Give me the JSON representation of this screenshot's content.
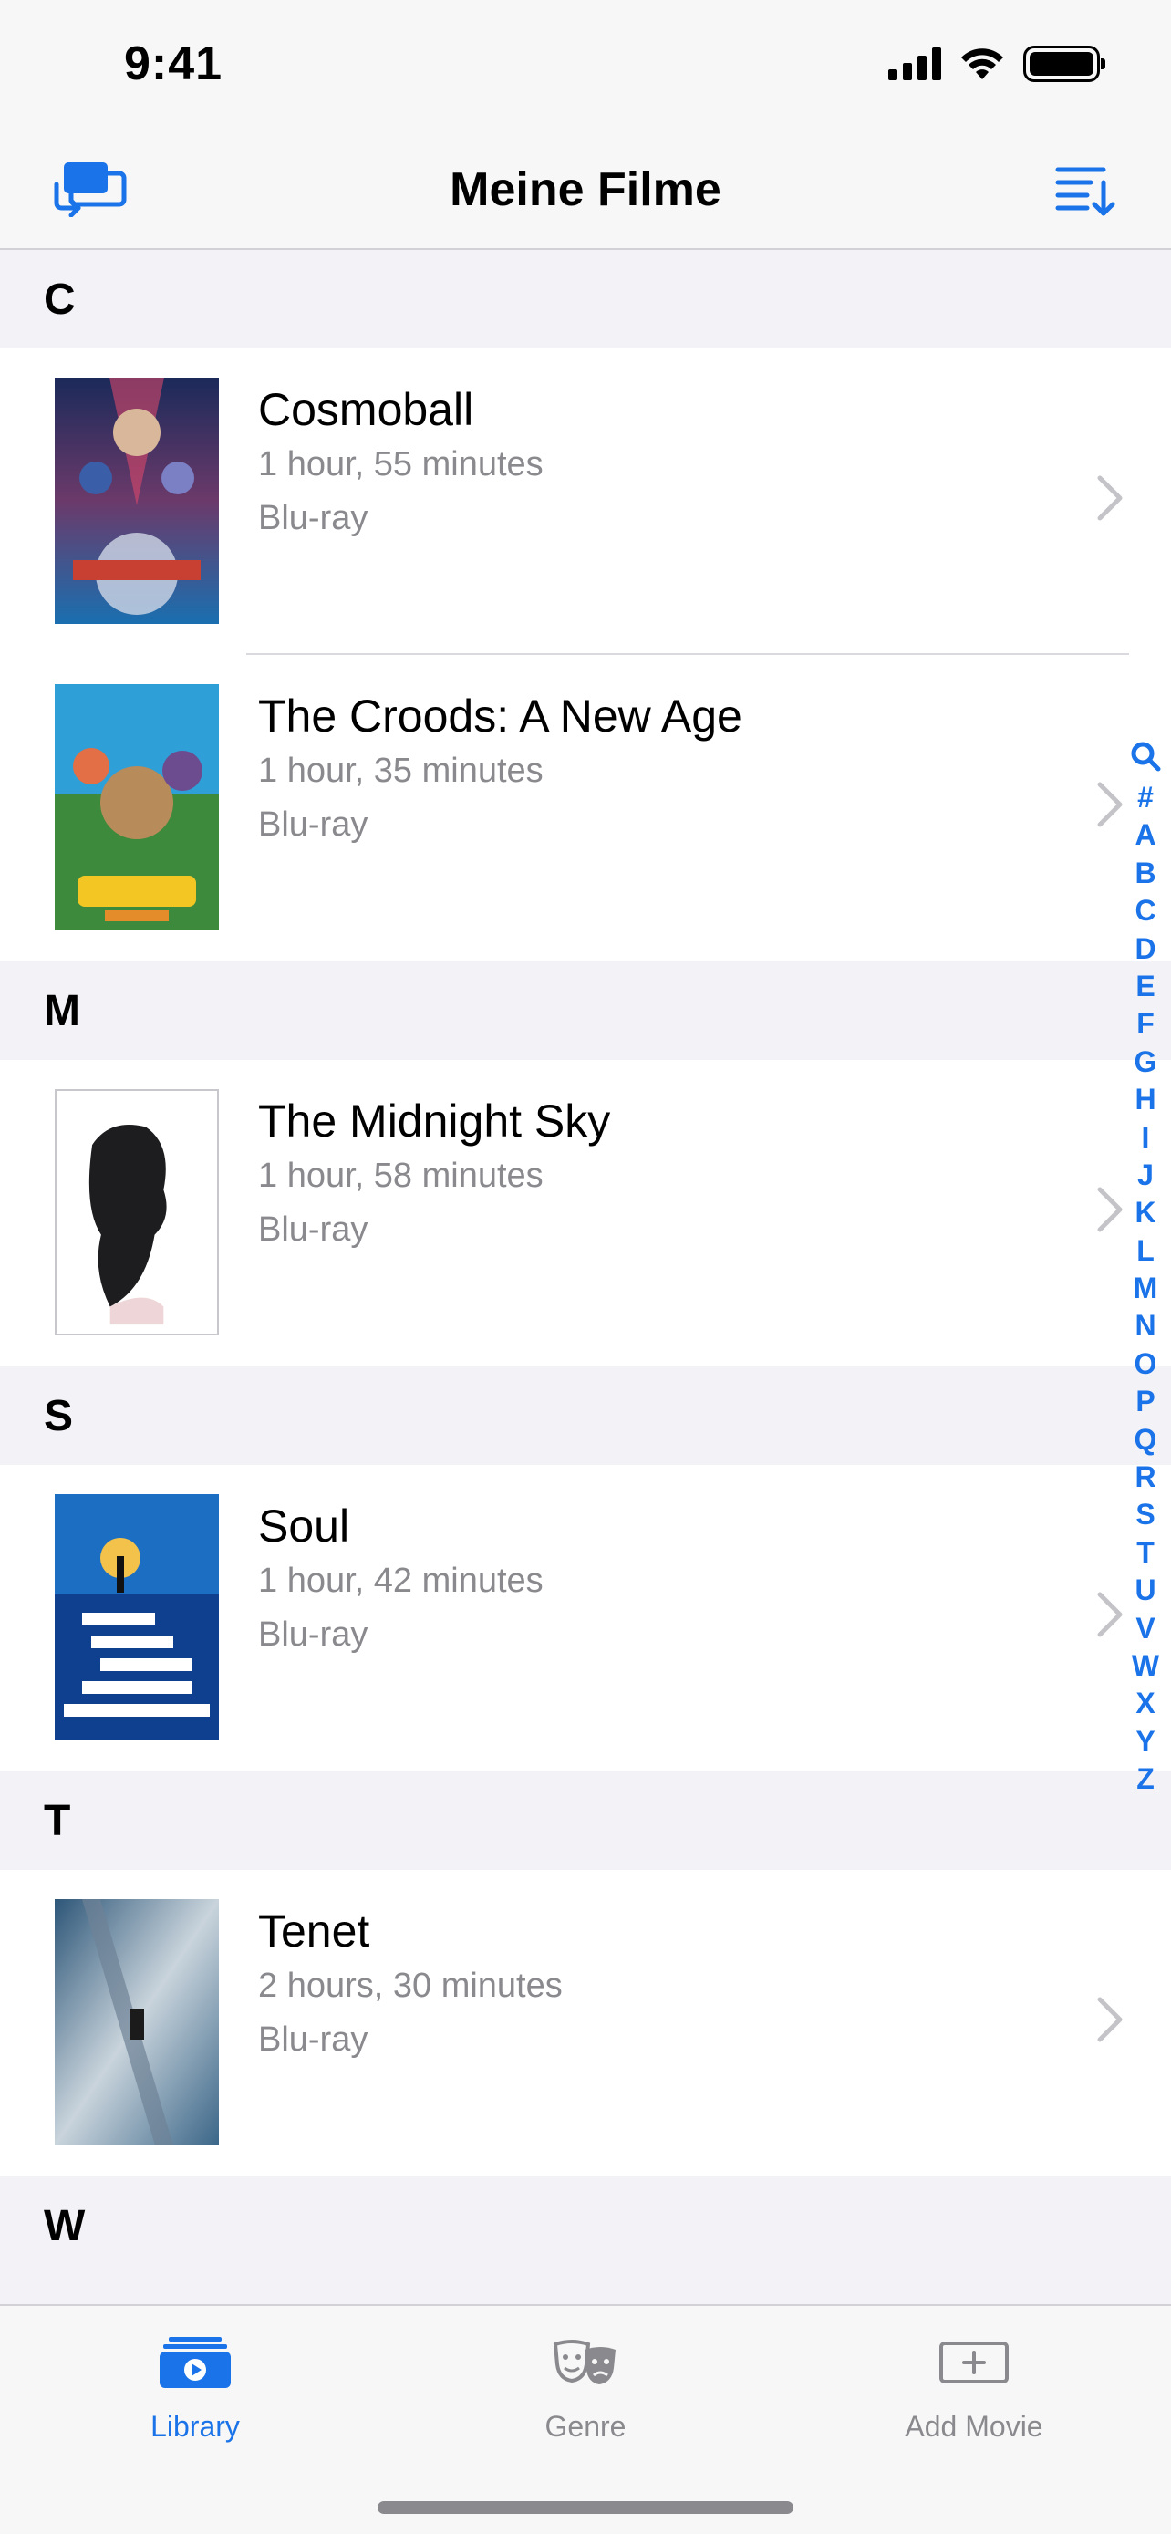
{
  "status": {
    "time": "9:41"
  },
  "nav": {
    "title": "Meine Filme",
    "left_icon": "cast-to-device-icon",
    "right_icon": "sort-icon"
  },
  "accent_color": "#1a73e8",
  "sections": [
    {
      "letter": "C",
      "movies": [
        {
          "title": "Cosmoball",
          "duration": "1 hour, 55 minutes",
          "format": "Blu-ray"
        },
        {
          "title": "The Croods: A New Age",
          "duration": "1 hour, 35 minutes",
          "format": "Blu-ray"
        }
      ]
    },
    {
      "letter": "M",
      "movies": [
        {
          "title": "The Midnight Sky",
          "duration": "1 hour, 58 minutes",
          "format": "Blu-ray"
        }
      ]
    },
    {
      "letter": "S",
      "movies": [
        {
          "title": "Soul",
          "duration": "1 hour, 42 minutes",
          "format": "Blu-ray"
        }
      ]
    },
    {
      "letter": "T",
      "movies": [
        {
          "title": "Tenet",
          "duration": "2 hours, 30 minutes",
          "format": "Blu-ray"
        }
      ]
    },
    {
      "letter": "W",
      "movies": []
    }
  ],
  "index": [
    "#",
    "A",
    "B",
    "C",
    "D",
    "E",
    "F",
    "G",
    "H",
    "I",
    "J",
    "K",
    "L",
    "M",
    "N",
    "O",
    "P",
    "Q",
    "R",
    "S",
    "T",
    "U",
    "V",
    "W",
    "X",
    "Y",
    "Z"
  ],
  "tabs": [
    {
      "label": "Library",
      "icon": "library-icon",
      "active": true
    },
    {
      "label": "Genre",
      "icon": "theater-masks-icon",
      "active": false
    },
    {
      "label": "Add Movie",
      "icon": "add-movie-icon",
      "active": false
    }
  ]
}
